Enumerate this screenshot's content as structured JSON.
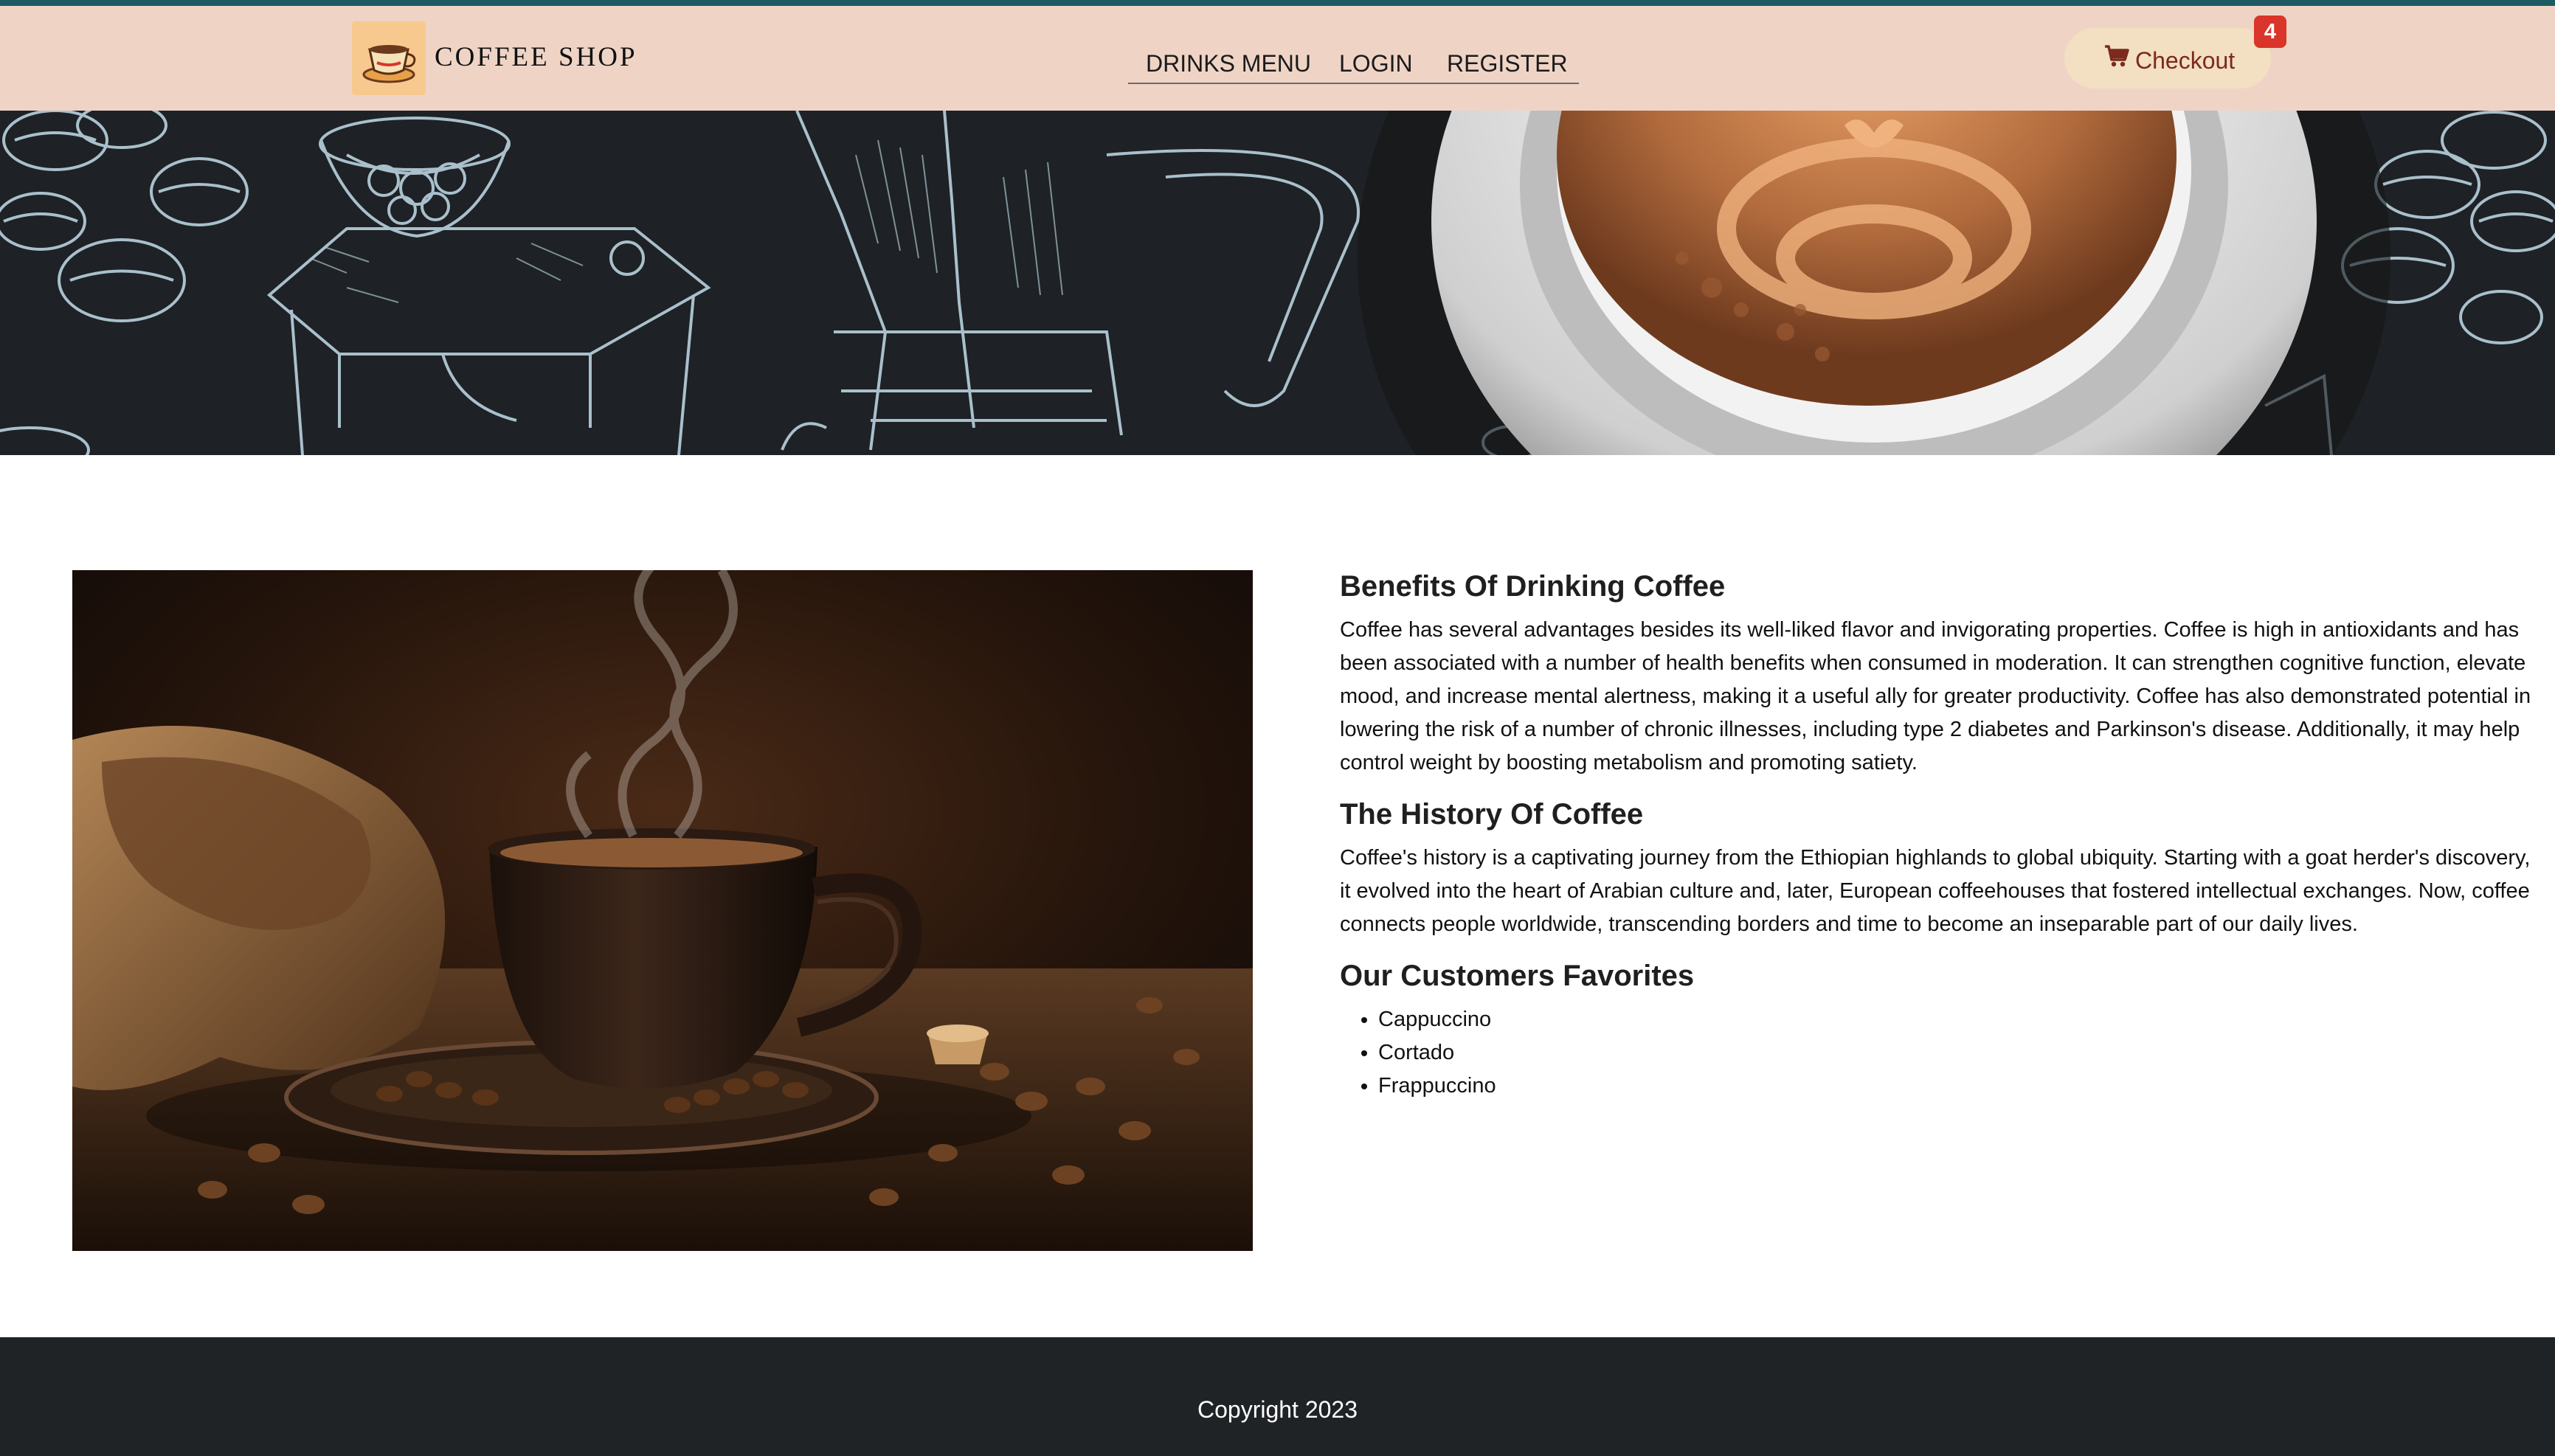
{
  "brand": {
    "name": "COFFEE SHOP",
    "logo_icon": "coffee-cup-logo-icon"
  },
  "nav": {
    "items": [
      {
        "label": "DRINKS MENU"
      },
      {
        "label": "LOGIN"
      },
      {
        "label": "REGISTER"
      }
    ]
  },
  "checkout": {
    "label": "Checkout",
    "icon": "cart-icon",
    "badge": "4"
  },
  "content": {
    "sections": [
      {
        "heading": "Benefits Of Drinking Coffee",
        "text": "Coffee has several advantages besides its well-liked flavor and invigorating properties. Coffee is high in antioxidants and has been associated with a number of health benefits when consumed in moderation. It can strengthen cognitive function, elevate mood, and increase mental alertness, making it a useful ally for greater productivity. Coffee has also demonstrated potential in lowering the risk of a number of chronic illnesses, including type 2 diabetes and Parkinson's disease. Additionally, it may help control weight by boosting metabolism and promoting satiety."
      },
      {
        "heading": "The History Of Coffee",
        "text": "Coffee's history is a captivating journey from the Ethiopian highlands to global ubiquity. Starting with a goat herder's discovery, it evolved into the heart of Arabian culture and, later, European coffeehouses that fostered intellectual exchanges. Now, coffee connects people worldwide, transcending borders and time to become an inseparable part of our daily lives."
      }
    ],
    "favorites": {
      "heading": "Our Customers Favorites",
      "items": [
        "Cappuccino",
        "Cortado",
        "Frappuccino"
      ]
    }
  },
  "footer": {
    "copyright": "Copyright 2023"
  },
  "colors": {
    "accent": "#1f5a62",
    "navbar_bg": "#efd4c6",
    "checkout_bg": "#f3dfc1",
    "checkout_text": "#7c2a1e",
    "badge_bg": "#d9352b",
    "hero_bg": "#1e2125",
    "hero_line": "#a9c0cc",
    "footer_bg": "#1f2326"
  }
}
